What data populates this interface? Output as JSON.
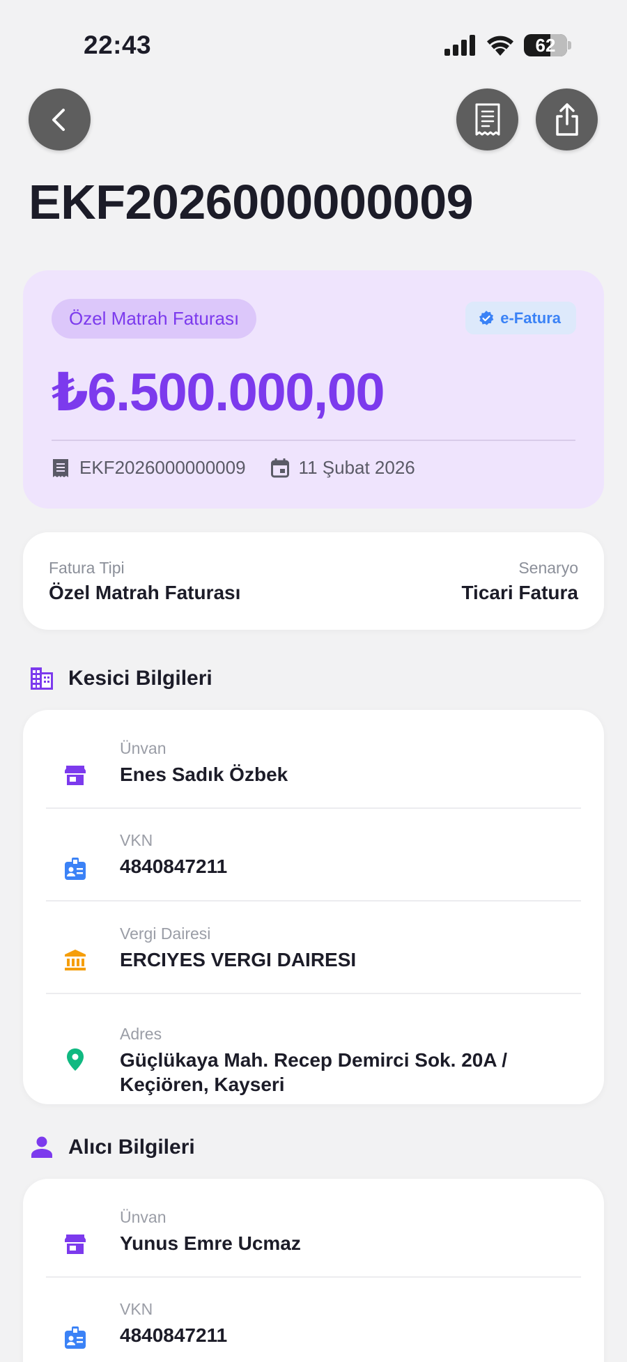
{
  "status_bar": {
    "time": "22:43",
    "battery": "62"
  },
  "nav": {
    "back_icon": "chevron-left-icon",
    "receipt_icon": "receipt-icon",
    "share_icon": "share-icon"
  },
  "invoice": {
    "title": "EKF2026000000009",
    "type_badge": "Özel Matrah Faturası",
    "efatura_badge": "e-Fatura",
    "amount": "₺6.500.000,00",
    "number": "EKF2026000000009",
    "date": "11 Şubat 2026"
  },
  "summary": {
    "type_label": "Fatura Tipi",
    "type_value": "Özel Matrah Faturası",
    "scenario_label": "Senaryo",
    "scenario_value": "Ticari Fatura"
  },
  "seller": {
    "title": "Kesici Bilgileri",
    "rows": [
      {
        "label": "Ünvan",
        "value": "Enes Sadık Özbek"
      },
      {
        "label": "VKN",
        "value": "4840847211"
      },
      {
        "label": "Vergi Dairesi",
        "value": "ERCIYES VERGI DAIRESI"
      },
      {
        "label": "Adres",
        "value_line1": "Güçlükaya Mah. Recep Demirci Sok. 20A /",
        "value_line2": "Keçiören, Kayseri"
      }
    ]
  },
  "buyer": {
    "title": "Alıcı Bilgileri",
    "rows": [
      {
        "label": "Ünvan",
        "value": "Yunus Emre Ucmaz"
      },
      {
        "label": "VKN",
        "value": "4840847211"
      }
    ]
  },
  "colors": {
    "accent": "#7c3aed",
    "blue": "#3b82f6",
    "orange": "#f59e0b",
    "green": "#10b981",
    "card_purple_bg": "#efe4fd"
  }
}
